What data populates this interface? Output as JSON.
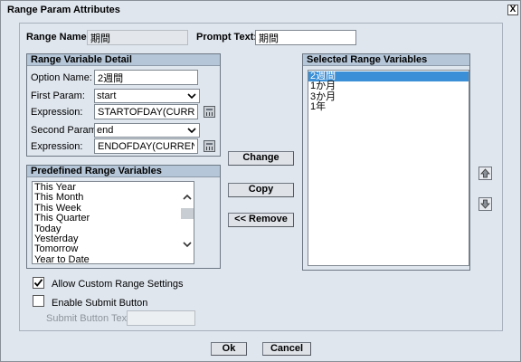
{
  "dialog": {
    "title": "Range Param Attributes",
    "close_label": "X"
  },
  "header": {
    "range_name_label": "Range Name:",
    "range_name_value": "期間",
    "prompt_text_label": "Prompt Text:",
    "prompt_text_value": "期間"
  },
  "range_detail": {
    "title": "Range Variable Detail",
    "option_name_label": "Option Name:",
    "option_name_value": "2週間",
    "first_param_label": "First Param:",
    "first_param_value": "start",
    "first_expression_label": "Expression:",
    "first_expression_value": "STARTOFDAY(CURRENT",
    "second_param_label": "Second Param:",
    "second_param_value": "end",
    "second_expression_label": "Expression:",
    "second_expression_value": "ENDOFDAY(CURRENTD"
  },
  "predefined": {
    "title": "Predefined Range Variables",
    "items": [
      "This Year",
      "This Month",
      "This Week",
      "This Quarter",
      "Today",
      "Yesterday",
      "Tomorrow",
      "Year to Date"
    ]
  },
  "actions": {
    "change": "Change",
    "copy": "Copy",
    "remove": "<< Remove"
  },
  "selected": {
    "title": "Selected Range Variables",
    "items": [
      "2週間",
      "1か月",
      "3か月",
      "1年"
    ],
    "selected_index": 0
  },
  "options": {
    "allow_custom_label": "Allow Custom Range Settings",
    "allow_custom_checked": true,
    "enable_submit_label": "Enable Submit Button",
    "enable_submit_checked": false,
    "submit_text_label": "Submit Button Text:",
    "submit_text_value": ""
  },
  "footer": {
    "ok": "Ok",
    "cancel": "Cancel"
  },
  "colors": {
    "background": "#dfe6ee",
    "group_header": "#b5c6d8",
    "selection": "#3a8fd6"
  }
}
